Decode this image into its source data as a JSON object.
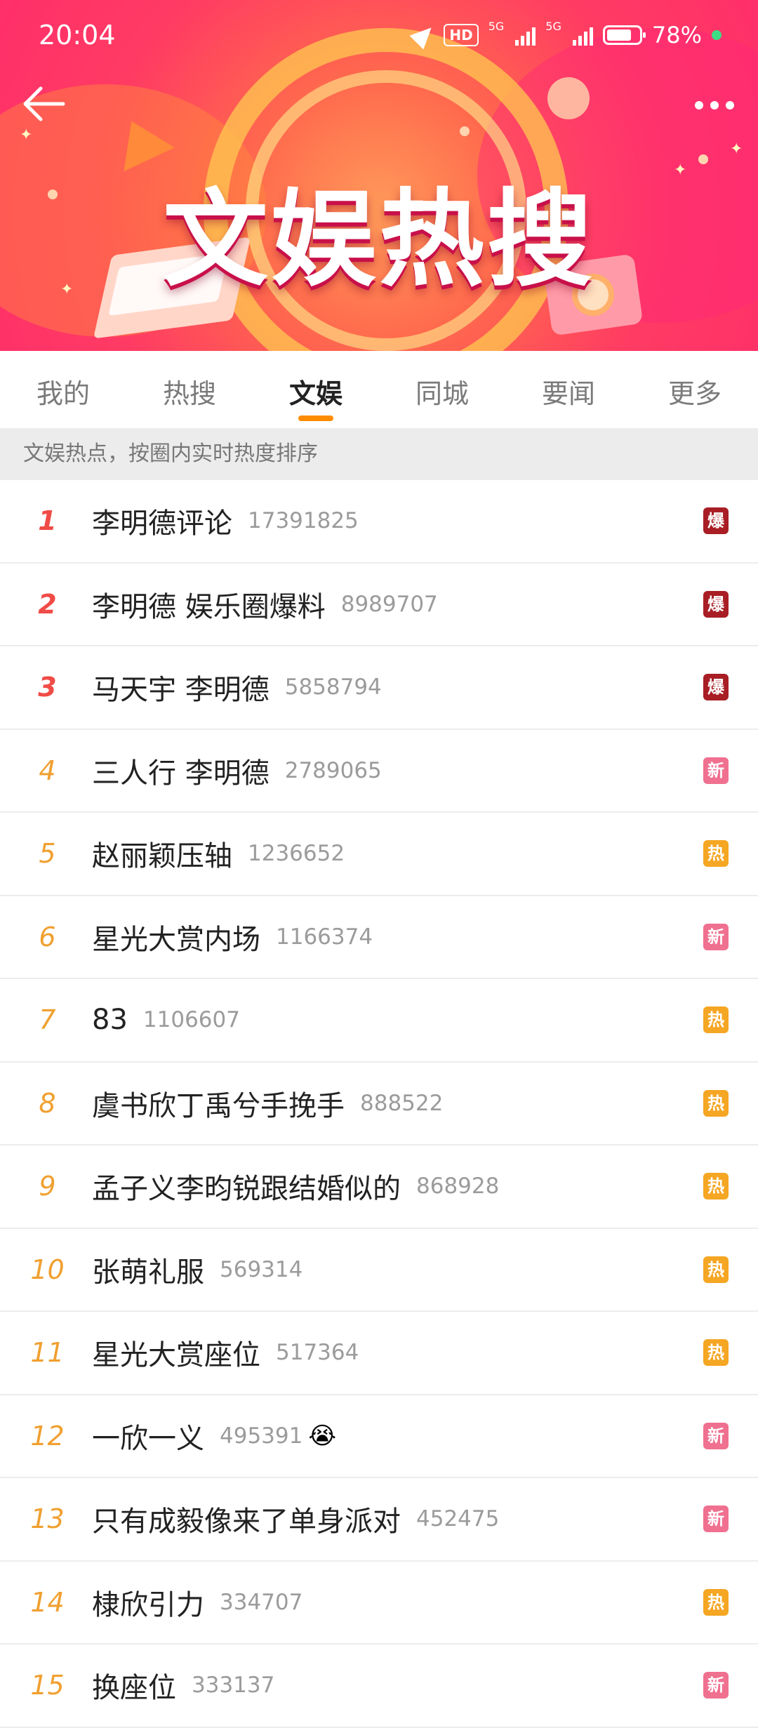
{
  "status_bar": {
    "time": "20:04",
    "hd": "HD",
    "sig1": "5G",
    "sig2": "5G",
    "battery": "78%"
  },
  "banner": {
    "title": "文娱热搜"
  },
  "tabs": [
    {
      "label": "我的"
    },
    {
      "label": "热搜"
    },
    {
      "label": "文娱",
      "active": true
    },
    {
      "label": "同城"
    },
    {
      "label": "要闻"
    },
    {
      "label": "更多"
    }
  ],
  "subtitle": "文娱热点，按圈内实时热度排序",
  "colors": {
    "accent": "#ff8c00",
    "rank_top": "#f04b46",
    "rank_other": "#f0a030",
    "badge_bao": "#a81e24",
    "badge_xin": "#f07090",
    "badge_re": "#f5a623"
  },
  "items": [
    {
      "rank": "1",
      "title": "李明德评论",
      "count": "17391825",
      "badge": "爆",
      "type": "bao"
    },
    {
      "rank": "2",
      "title": "李明德 娱乐圈爆料",
      "count": "8989707",
      "badge": "爆",
      "type": "bao"
    },
    {
      "rank": "3",
      "title": "马天宇 李明德",
      "count": "5858794",
      "badge": "爆",
      "type": "bao"
    },
    {
      "rank": "4",
      "title": "三人行 李明德",
      "count": "2789065",
      "badge": "新",
      "type": "xin"
    },
    {
      "rank": "5",
      "title": "赵丽颖压轴",
      "count": "1236652",
      "badge": "热",
      "type": "re"
    },
    {
      "rank": "6",
      "title": "星光大赏内场",
      "count": "1166374",
      "badge": "新",
      "type": "xin"
    },
    {
      "rank": "7",
      "title": "83",
      "count": "1106607",
      "badge": "热",
      "type": "re"
    },
    {
      "rank": "8",
      "title": "虞书欣丁禹兮手挽手",
      "count": "888522",
      "badge": "热",
      "type": "re"
    },
    {
      "rank": "9",
      "title": "孟子义李昀锐跟结婚似的",
      "count": "868928",
      "badge": "热",
      "type": "re"
    },
    {
      "rank": "10",
      "title": "张萌礼服",
      "count": "569314",
      "badge": "热",
      "type": "re"
    },
    {
      "rank": "11",
      "title": "星光大赏座位",
      "count": "517364",
      "badge": "热",
      "type": "re"
    },
    {
      "rank": "12",
      "title": "一欣一义",
      "count": "495391",
      "emoji": "😭",
      "badge": "新",
      "type": "xin"
    },
    {
      "rank": "13",
      "title": "只有成毅像来了单身派对",
      "count": "452475",
      "badge": "新",
      "type": "xin"
    },
    {
      "rank": "14",
      "title": "棣欣引力",
      "count": "334707",
      "badge": "热",
      "type": "re"
    },
    {
      "rank": "15",
      "title": "换座位",
      "count": "333137",
      "badge": "新",
      "type": "xin"
    }
  ]
}
